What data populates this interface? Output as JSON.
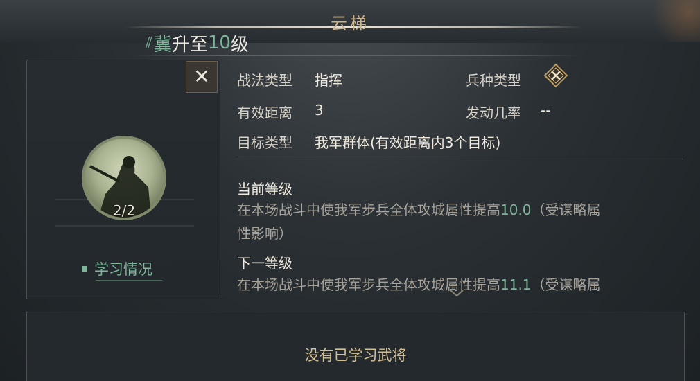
{
  "header": {
    "title": "云梯",
    "upgrade_prefix_icon": "level-up-icon",
    "upgrade_icon_text": "⸻",
    "upgrade_word1": "冀",
    "upgrade_word2": "升至",
    "upgrade_level": "10",
    "upgrade_word3": "级"
  },
  "skill_card": {
    "close_label": "✕",
    "count": "2/2",
    "learn_label": "学习情况"
  },
  "info": {
    "tactic_type_label": "战法类型",
    "tactic_type_value": "指挥",
    "arm_type_label": "兵种类型",
    "arm_type_icon": "crossed-weapons-icon",
    "range_label": "有效距离",
    "range_value": "3",
    "trigger_label": "发动几率",
    "trigger_value": "--",
    "target_label": "目标类型",
    "target_value": "我军群体(有效距离内3个目标)"
  },
  "current_level": {
    "title": "当前等级",
    "desc_prefix": "在本场战斗中使我军步兵全体攻城属性提高",
    "desc_value": "10.0",
    "desc_suffix_line1": "（受谋略属",
    "desc_line2": "性影响）"
  },
  "next_level": {
    "title": "下一等级",
    "desc_prefix": "在本场战斗中使我军步兵全体攻城属性提高",
    "desc_value": "11.1",
    "desc_suffix_line1": "（受谋略属"
  },
  "bottom": {
    "empty_text": "没有已学习武将"
  },
  "colors": {
    "accent_green": "#7fb59a",
    "gold_text": "#d2c094",
    "title_gold": "#c9b48c"
  }
}
